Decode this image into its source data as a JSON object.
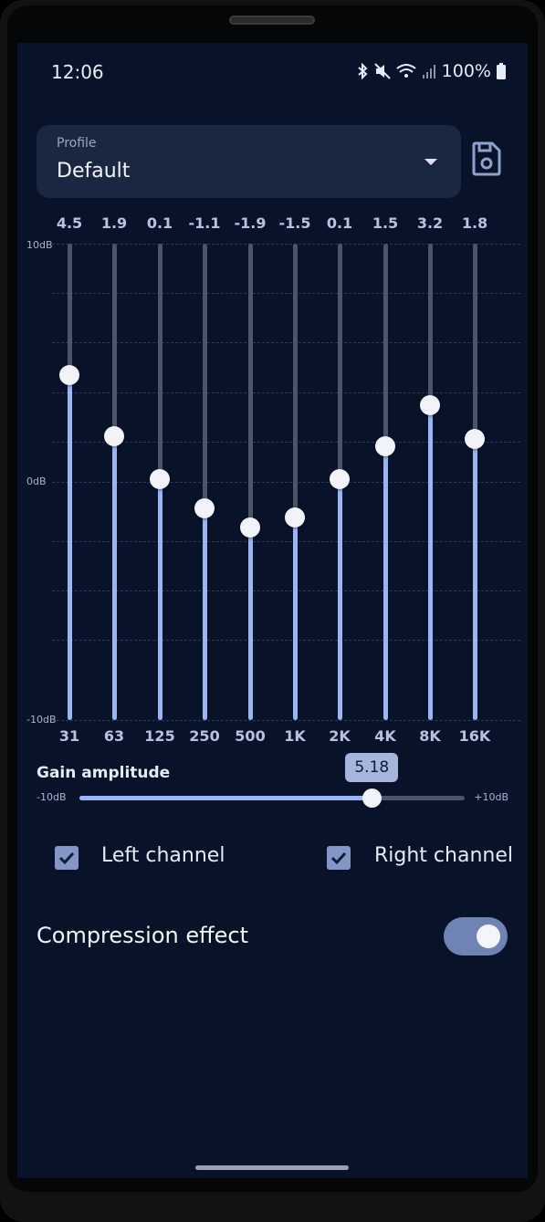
{
  "status": {
    "time": "12:06",
    "battery": "100%"
  },
  "profile": {
    "label": "Profile",
    "value": "Default"
  },
  "equalizer": {
    "bands": [
      {
        "freq": "31",
        "gain": "4.5",
        "value": 4.5
      },
      {
        "freq": "63",
        "gain": "1.9",
        "value": 1.9
      },
      {
        "freq": "125",
        "gain": "0.1",
        "value": 0.1
      },
      {
        "freq": "250",
        "gain": "-1.1",
        "value": -1.1
      },
      {
        "freq": "500",
        "gain": "-1.9",
        "value": -1.9
      },
      {
        "freq": "1K",
        "gain": "-1.5",
        "value": -1.5
      },
      {
        "freq": "2K",
        "gain": "0.1",
        "value": 0.1
      },
      {
        "freq": "4K",
        "gain": "1.5",
        "value": 1.5
      },
      {
        "freq": "8K",
        "gain": "3.2",
        "value": 3.2
      },
      {
        "freq": "16K",
        "gain": "1.8",
        "value": 1.8
      }
    ],
    "axis_top": "10dB",
    "axis_mid": "0dB",
    "axis_bottom": "-10dB"
  },
  "gain_amplitude": {
    "title": "Gain amplitude",
    "min_label": "-10dB",
    "max_label": "+10dB",
    "value": "5.18",
    "fraction": 0.759
  },
  "channels": {
    "left_label": "Left channel",
    "left_checked": true,
    "right_label": "Right channel",
    "right_checked": true
  },
  "compression": {
    "label": "Compression effect",
    "enabled": true
  },
  "colors": {
    "background": "#08132a",
    "accent": "#9ab4f4",
    "track": "#4b5568"
  }
}
